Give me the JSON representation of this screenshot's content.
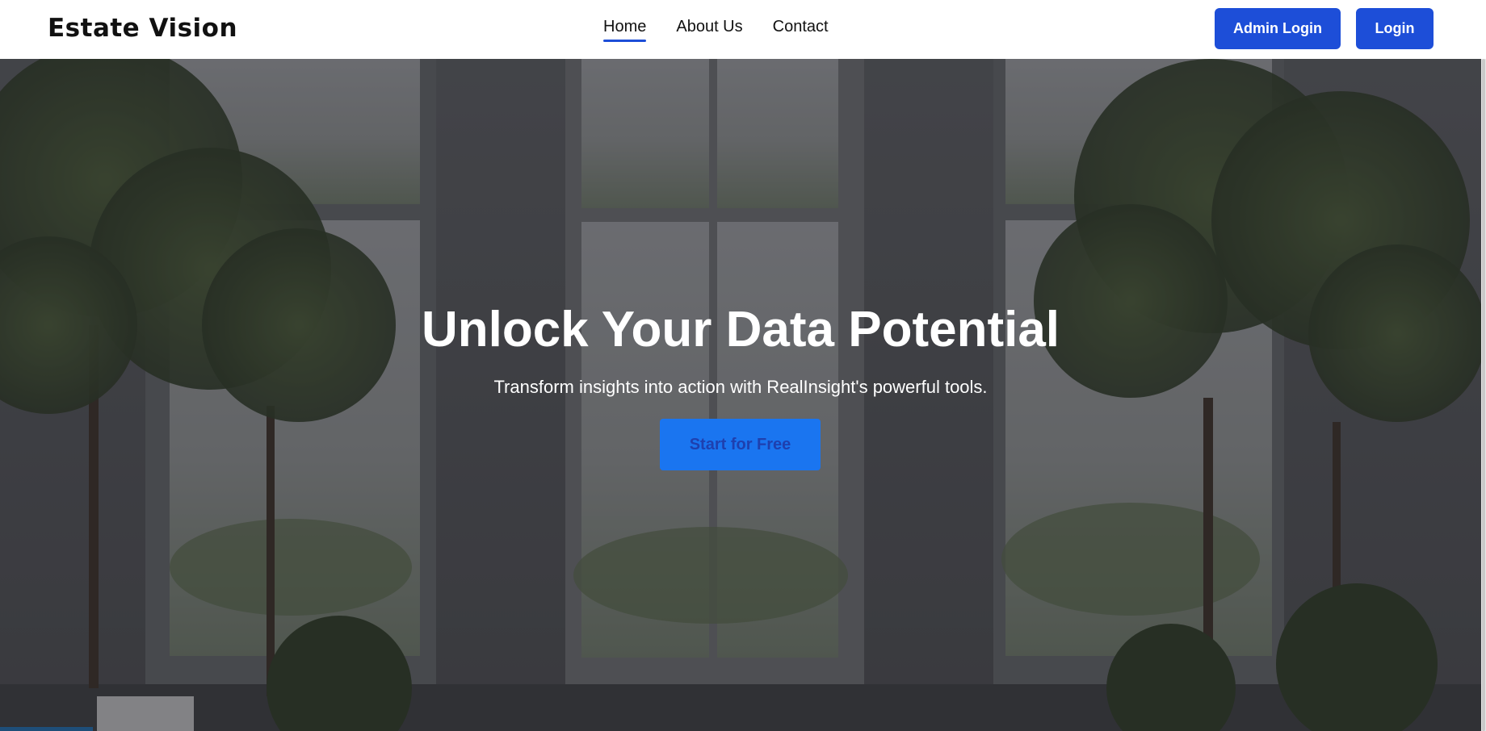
{
  "brand": {
    "name": "Estate Vision"
  },
  "nav": {
    "links": [
      {
        "label": "Home",
        "active": true
      },
      {
        "label": "About Us",
        "active": false
      },
      {
        "label": "Contact",
        "active": false
      }
    ],
    "admin_login_label": "Admin Login",
    "login_label": "Login"
  },
  "hero": {
    "title": "Unlock Your Data Potential",
    "subtitle": "Transform insights into action with RealInsight's powerful tools.",
    "cta_label": "Start for Free",
    "background_image": "interior-windows-with-trees"
  },
  "colors": {
    "primary": "#1d4ed8",
    "cta": "#1a75f0",
    "nav_bg": "#ffffff"
  }
}
